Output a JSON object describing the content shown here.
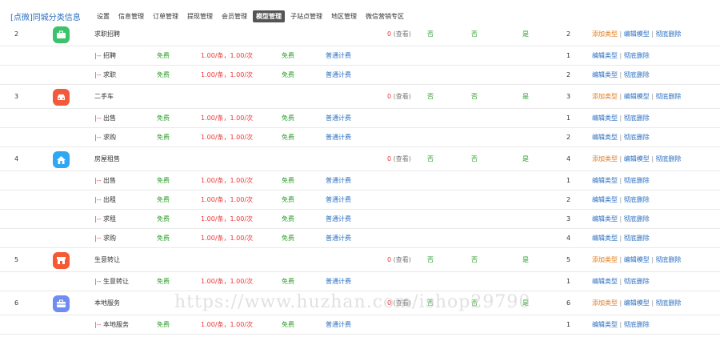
{
  "brand": "[点微]同城分类信息",
  "nav": [
    "设置",
    "信息管理",
    "订单管理",
    "提现管理",
    "会员管理",
    "模型管理",
    "子站点管理",
    "地区管理",
    "微信营销专区"
  ],
  "nav_active_index": 5,
  "colors": {
    "green_icon": "#3cc26b",
    "red_icon": "#f25a3c",
    "blue_icon": "#2fa7f2",
    "orange_icon": "#f55a33",
    "purple_icon": "#6f8df0"
  },
  "rows": [
    {
      "kind": "parent",
      "id": "2",
      "icon": "briefcase-icon",
      "icon_color": "#3cc26b",
      "name": "求职招聘",
      "count": "0",
      "see": "(查看)",
      "f1": "否",
      "f2": "否",
      "f3": "是",
      "order": "2",
      "actions": [
        "添加类型",
        "编辑模型",
        "彻底删除"
      ]
    },
    {
      "kind": "sub",
      "name": "|-- 招聘",
      "free": "免费",
      "price": "1.00/条，1.00/次",
      "free2": "免费",
      "bill": "普通计费",
      "order": "1",
      "actions": [
        "编辑类型",
        "彻底删除"
      ]
    },
    {
      "kind": "sub",
      "name": "|-- 求职",
      "free": "免费",
      "price": "1.00/条，1.00/次",
      "free2": "免费",
      "bill": "普通计费",
      "order": "2",
      "actions": [
        "编辑类型",
        "彻底删除"
      ]
    },
    {
      "kind": "parent",
      "id": "3",
      "icon": "car-icon",
      "icon_color": "#f25a3c",
      "name": "二手车",
      "count": "0",
      "see": "(查看)",
      "f1": "否",
      "f2": "否",
      "f3": "是",
      "order": "3",
      "actions": [
        "添加类型",
        "编辑模型",
        "彻底删除"
      ]
    },
    {
      "kind": "sub",
      "name": "|-- 出售",
      "free": "免费",
      "price": "1.00/条，1.00/次",
      "free2": "免费",
      "bill": "普通计费",
      "order": "1",
      "actions": [
        "编辑类型",
        "彻底删除"
      ]
    },
    {
      "kind": "sub",
      "name": "|-- 求购",
      "free": "免费",
      "price": "1.00/条，1.00/次",
      "free2": "免费",
      "bill": "普通计费",
      "order": "2",
      "actions": [
        "编辑类型",
        "彻底删除"
      ]
    },
    {
      "kind": "parent",
      "id": "4",
      "icon": "house-icon",
      "icon_color": "#2fa7f2",
      "name": "房屋租售",
      "count": "0",
      "see": "(查看)",
      "f1": "否",
      "f2": "否",
      "f3": "是",
      "order": "4",
      "actions": [
        "添加类型",
        "编辑模型",
        "彻底删除"
      ]
    },
    {
      "kind": "sub",
      "name": "|-- 出售",
      "free": "免费",
      "price": "1.00/条，1.00/次",
      "free2": "免费",
      "bill": "普通计费",
      "order": "1",
      "actions": [
        "编辑类型",
        "彻底删除"
      ]
    },
    {
      "kind": "sub",
      "name": "|-- 出租",
      "free": "免费",
      "price": "1.00/条，1.00/次",
      "free2": "免费",
      "bill": "普通计费",
      "order": "2",
      "actions": [
        "编辑类型",
        "彻底删除"
      ]
    },
    {
      "kind": "sub",
      "name": "|-- 求租",
      "free": "免费",
      "price": "1.00/条，1.00/次",
      "free2": "免费",
      "bill": "普通计费",
      "order": "3",
      "actions": [
        "编辑类型",
        "彻底删除"
      ]
    },
    {
      "kind": "sub",
      "name": "|-- 求购",
      "free": "免费",
      "price": "1.00/条，1.00/次",
      "free2": "免费",
      "bill": "普通计费",
      "order": "4",
      "actions": [
        "编辑类型",
        "彻底删除"
      ]
    },
    {
      "kind": "parent",
      "id": "5",
      "icon": "shop-icon",
      "icon_color": "#f55a33",
      "name": "生意转让",
      "count": "0",
      "see": "(查看)",
      "f1": "否",
      "f2": "否",
      "f3": "是",
      "order": "5",
      "actions": [
        "添加类型",
        "编辑模型",
        "彻底删除"
      ]
    },
    {
      "kind": "sub",
      "name": "|-- 生意转让",
      "free": "免费",
      "price": "1.00/条，1.00/次",
      "free2": "免费",
      "bill": "普通计费",
      "order": "1",
      "actions": [
        "编辑类型",
        "彻底删除"
      ]
    },
    {
      "kind": "parent",
      "id": "6",
      "icon": "toolbox-icon",
      "icon_color": "#6f8df0",
      "name": "本地服务",
      "count": "0",
      "see": "(查看)",
      "f1": "否",
      "f2": "否",
      "f3": "是",
      "order": "6",
      "actions": [
        "添加类型",
        "编辑模型",
        "彻底删除"
      ]
    },
    {
      "kind": "sub",
      "name": "|-- 本地服务",
      "free": "免费",
      "price": "1.00/条，1.00/次",
      "free2": "免费",
      "bill": "普通计费",
      "order": "1",
      "actions": [
        "编辑类型",
        "彻底删除"
      ]
    }
  ],
  "watermark": "https://www.huzhan.com/ishop29790"
}
